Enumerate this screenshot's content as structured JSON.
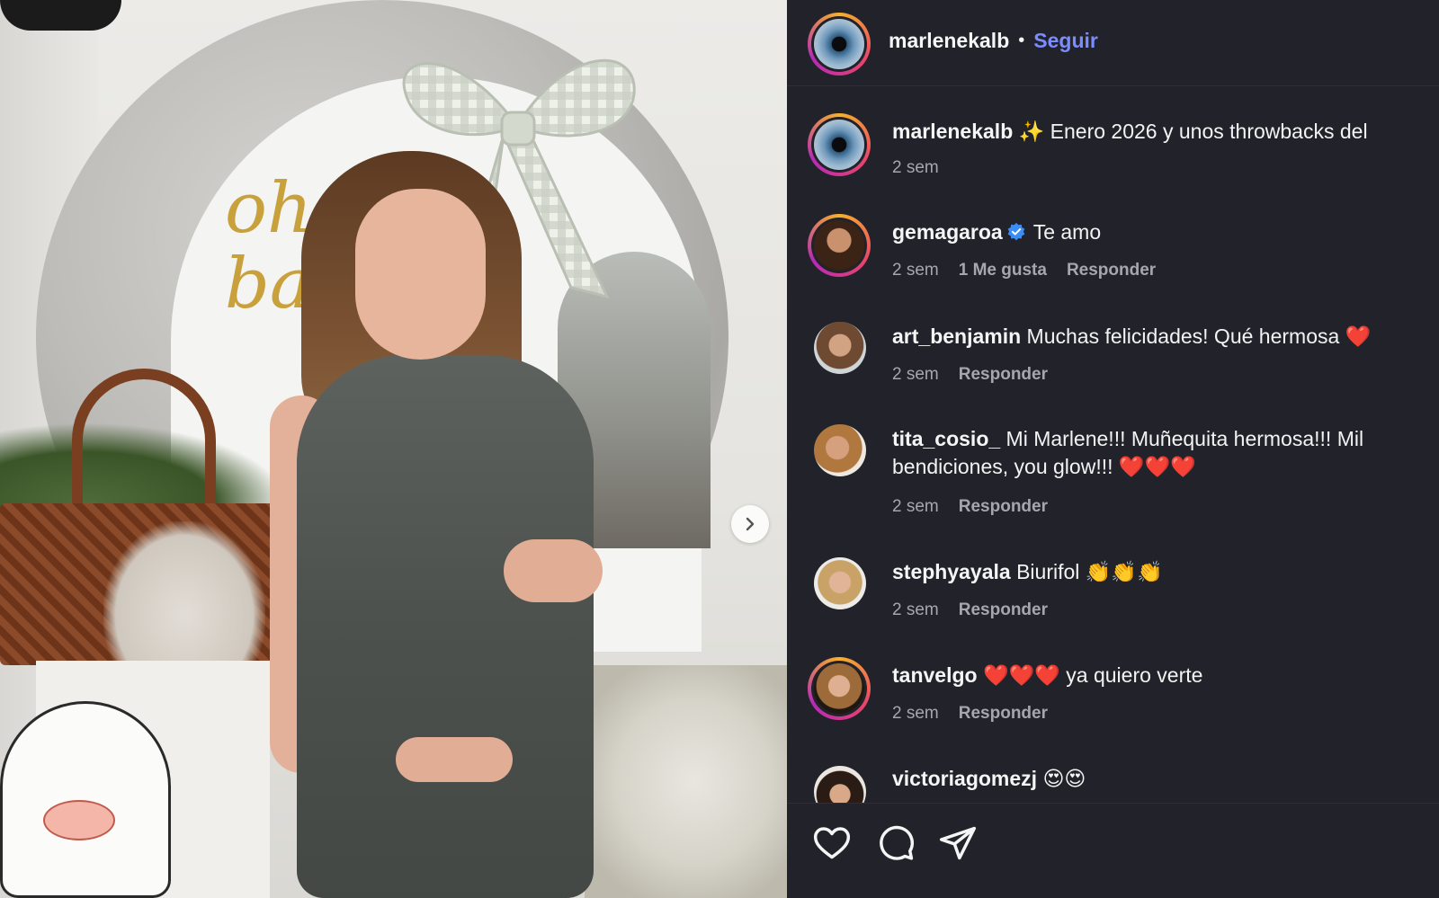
{
  "post": {
    "author": "marlenekalb",
    "separator": "•",
    "follow_label": "Seguir",
    "caption": "✨ Enero 2026 y unos throwbacks del",
    "caption_time": "2 sem"
  },
  "comments": [
    {
      "user": "gemagaroa",
      "verified": true,
      "text": "Te amo",
      "time": "2 sem",
      "likes": "1 Me gusta",
      "reply": "Responder"
    },
    {
      "user": "art_benjamin",
      "text": "Muchas felicidades! Qué hermosa ❤️",
      "time": "2 sem",
      "reply": "Responder"
    },
    {
      "user": "tita_cosio_",
      "text": "Mi Marlene!!! Muñequita hermosa!!! Mil bendiciones, you glow!!! ❤️❤️❤️",
      "time": "2 sem",
      "reply": "Responder"
    },
    {
      "user": "stephyayala",
      "text": "Biurifol 👏👏👏",
      "time": "2 sem",
      "reply": "Responder"
    },
    {
      "user": "tanvelgo",
      "text": "❤️❤️❤️ ya quiero verte",
      "time": "2 sem",
      "reply": "Responder"
    },
    {
      "user": "victoriagomezj",
      "text": "😍😍"
    }
  ],
  "icons": {
    "like": "heart-icon",
    "comment": "comment-icon",
    "share": "send-icon",
    "next": "chevron-right-icon"
  },
  "colors": {
    "panel_bg": "#22232a",
    "follow": "#7b8cff",
    "verified": "#3b8df5"
  }
}
